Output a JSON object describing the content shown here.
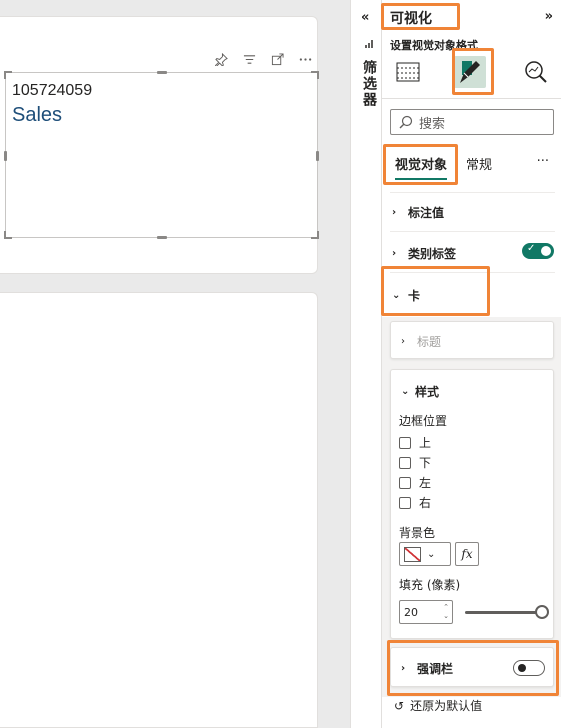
{
  "visual": {
    "value": "105724059",
    "label": "Sales",
    "header_icons": [
      "pin-icon",
      "filter-icon",
      "focus-mode-icon",
      "more-options-icon"
    ]
  },
  "filters": {
    "title": "筛选器",
    "collapse_icon": "«"
  },
  "pane": {
    "title": "可视化",
    "expand_icon": "»",
    "subtitle": "设置视觉对象格式",
    "search_placeholder": "搜索",
    "tabs": {
      "visual": "视觉对象",
      "general": "常规",
      "more": "···"
    },
    "sections": {
      "callout": "标注值",
      "category_label": "类别标签",
      "card": "卡"
    },
    "card_group": {
      "title_sub": "标题",
      "style": "样式",
      "border_position": "边框位置",
      "checks": [
        "上",
        "下",
        "左",
        "右"
      ],
      "background_color": "背景色",
      "fx": "fx",
      "padding_label": "填充 (像素)",
      "padding_value": "20",
      "accent_bar": "强调栏"
    },
    "reset": "还原为默认值"
  },
  "colors": {
    "accent": "#117865",
    "highlight": "#f08437",
    "kpi_label": "#1e4e79"
  }
}
